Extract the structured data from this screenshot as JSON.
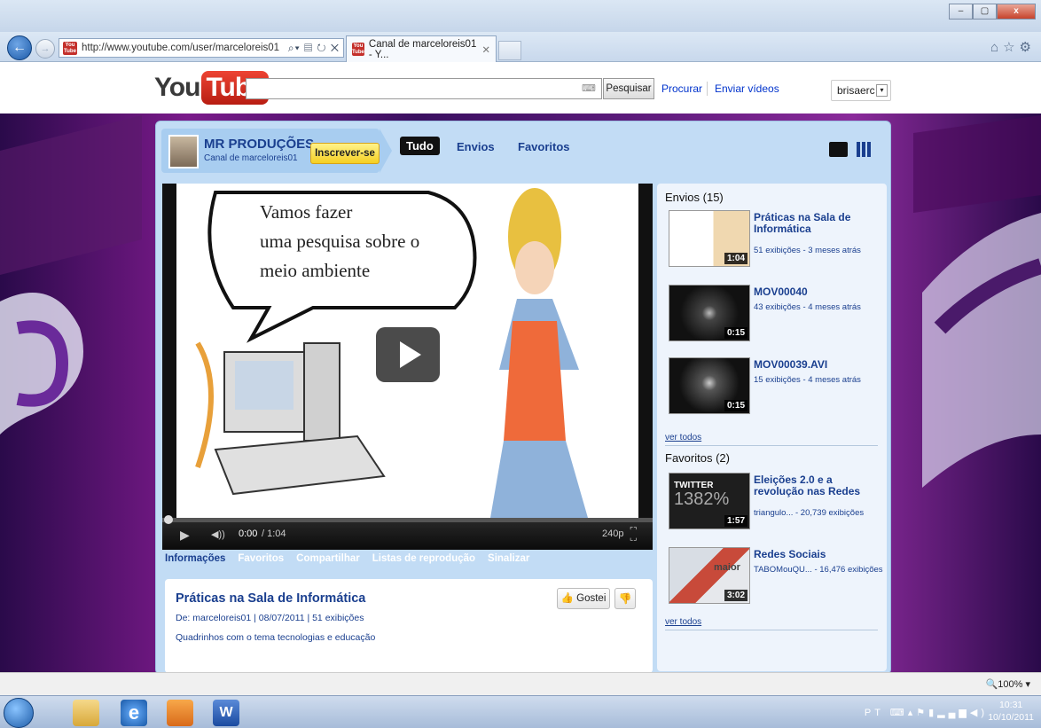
{
  "browser": {
    "address_url": "http://www.youtube.com/user/marceloreis01",
    "tab_title": "Canal de marceloreis01 - Y...",
    "window_controls": [
      "–",
      "▢",
      "x"
    ],
    "nav_right_icons": [
      "home-icon",
      "star-icon",
      "gear-icon"
    ]
  },
  "header": {
    "logo_you": "You",
    "logo_tube": "Tube",
    "search_button": "Pesquisar",
    "browse_link": "Procurar",
    "upload_link": "Enviar vídeos",
    "user": "brisaerc"
  },
  "channel": {
    "name": "MR PRODUÇÕES",
    "subtitle": "Canal de marceloreis01",
    "subscribe": "Inscrever-se",
    "tabs": [
      "Tudo",
      "Envios",
      "Favoritos"
    ]
  },
  "player": {
    "speech_text": [
      "Vamos fazer",
      "uma pesquisa sobre o",
      "meio ambiente"
    ],
    "time_current": "0:00",
    "time_total": "/ 1:04",
    "quality": "240p",
    "progress": 0
  },
  "info_tabs": [
    "Informações",
    "Favoritos",
    "Compartilhar",
    "Listas de reprodução",
    "Sinalizar"
  ],
  "video_info": {
    "title": "Práticas na Sala de Informática",
    "meta": "De: marceloreis01 | 08/07/2011 | 51 exibições",
    "description": "Quadrinhos com o tema tecnologias e educação",
    "like": "Gostei"
  },
  "sidebar": {
    "uploads_title": "Envios (15)",
    "uploads": [
      {
        "title": "Práticas na Sala de Informática",
        "meta": "51 exibições - 3 meses atrás",
        "duration": "1:04"
      },
      {
        "title": "MOV00040",
        "meta": "43 exibições - 4 meses atrás",
        "duration": "0:15"
      },
      {
        "title": "MOV00039.AVI",
        "meta": "15 exibições - 4 meses atrás",
        "duration": "0:15"
      }
    ],
    "see_all": "ver todos",
    "favorites_title": "Favoritos (2)",
    "favorites": [
      {
        "title": "Eleições 2.0 e a revolução nas Redes",
        "meta": "triangulo... - 20,739 exibições",
        "duration": "1:57",
        "thumb_text": "TWITTER",
        "thumb_num": "1382%"
      },
      {
        "title": "Redes Sociais",
        "meta": "TABOMouQU... - 16,476 exibições",
        "duration": "3:02",
        "thumb_text": "maior"
      }
    ]
  },
  "status": {
    "zoom": "100%"
  },
  "taskbar": {
    "lang": "PT",
    "time": "10:31",
    "date": "10/10/2011"
  }
}
